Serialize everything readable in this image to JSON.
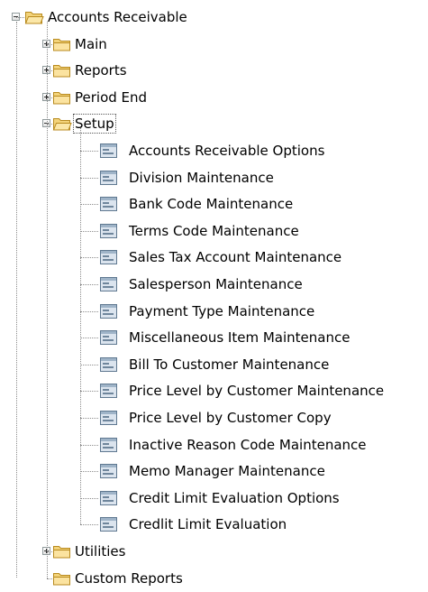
{
  "tree": {
    "root": {
      "label": "Accounts Receivable",
      "expanded": true,
      "icon": "folder-open-icon",
      "children": [
        {
          "label": "Main",
          "expanded": false,
          "icon": "folder-icon"
        },
        {
          "label": "Reports",
          "expanded": false,
          "icon": "folder-icon"
        },
        {
          "label": "Period End",
          "expanded": false,
          "icon": "folder-icon"
        },
        {
          "label": "Setup",
          "expanded": true,
          "selected": true,
          "icon": "folder-open-icon",
          "items": [
            "Accounts Receivable Options",
            "Division Maintenance",
            "Bank Code Maintenance",
            "Terms Code Maintenance",
            "Sales Tax Account Maintenance",
            "Salesperson Maintenance",
            "Payment Type Maintenance",
            "Miscellaneous Item Maintenance",
            "Bill To Customer Maintenance",
            "Price Level by Customer Maintenance",
            "Price Level by Customer Copy",
            "Inactive Reason Code Maintenance",
            "Memo Manager Maintenance",
            "Credit Limit Evaluation Options",
            "Credlit Limit Evaluation"
          ]
        },
        {
          "label": "Utilities",
          "expanded": false,
          "icon": "folder-icon"
        },
        {
          "label": "Custom Reports",
          "expanded": false,
          "no_expander": true,
          "icon": "folder-icon"
        }
      ]
    }
  },
  "colors": {
    "folder_fill": "#f3d37a",
    "folder_edge": "#b88a1e",
    "form_fill": "#9fb4c8",
    "form_edge": "#5f7890",
    "guide": "#8c8c8c"
  }
}
